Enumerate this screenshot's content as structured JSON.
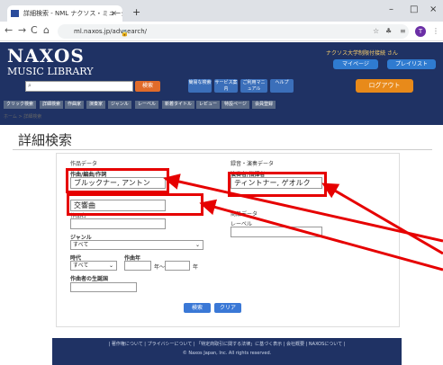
{
  "browser": {
    "tab_title": "詳細検索 - NML ナクソス・ミュージ",
    "tab_close": "×",
    "new_tab": "+",
    "minimize": "–",
    "maximize": "□",
    "close": "×",
    "url": "ml.naxos.jp/advsearch/",
    "profile_initial": "T"
  },
  "site": {
    "logo_line1": "NAXOS",
    "logo_line2": "MUSIC LIBRARY",
    "user_text": "ナクソス大学制限付接続 さん",
    "mypage": "マイページ",
    "playlist": "プレイリスト",
    "search_button": "検索",
    "shortcuts": [
      "簡易な検索",
      "サービス案内",
      "ご利用マニュアル",
      "ヘルプ"
    ],
    "logout": "ログアウト",
    "nav": [
      "クリック検索",
      "詳細検索",
      "作曲家",
      "演奏家",
      "ジャンル",
      "レーベル",
      "新着タイトル",
      "レビュー",
      "特設ページ",
      "会員登録"
    ]
  },
  "breadcrumb": "ホーム > 詳細検索",
  "page_title": "詳細検索",
  "form": {
    "section_work": "作品データ",
    "composer_label": "作曲/編曲/作詞",
    "composer_value": "ブルックナー, アントン",
    "work_value": "交響曲",
    "work_label_hidden": "作品名",
    "genre_label": "ジャンル",
    "genre_value": "すべて",
    "era_label": "時代",
    "era_value": "すべて",
    "year_label": "作曲年",
    "year_from_suffix": "年～",
    "year_to_suffix": "年",
    "birthplace_label": "作曲者の生誕国",
    "section_recording": "録音・演奏データ",
    "performer_label": "演奏者/指揮者",
    "performer_value": "ティントナー, ゲオルク",
    "section_disc": "商品データ",
    "label_label": "レーベル",
    "search": "検索",
    "clear": "クリア"
  },
  "footer": {
    "links": "| 著作権について | プライバシーについて | 「特定商取引に関する法律」に基づく表示 | 会社概要 | NAXOSについて |",
    "copyright": "© Naxos Japan, Inc. All rights reserved."
  },
  "colors": {
    "header": "#1f3264",
    "annotation": "#e60000",
    "accent": "#e06b2a"
  }
}
